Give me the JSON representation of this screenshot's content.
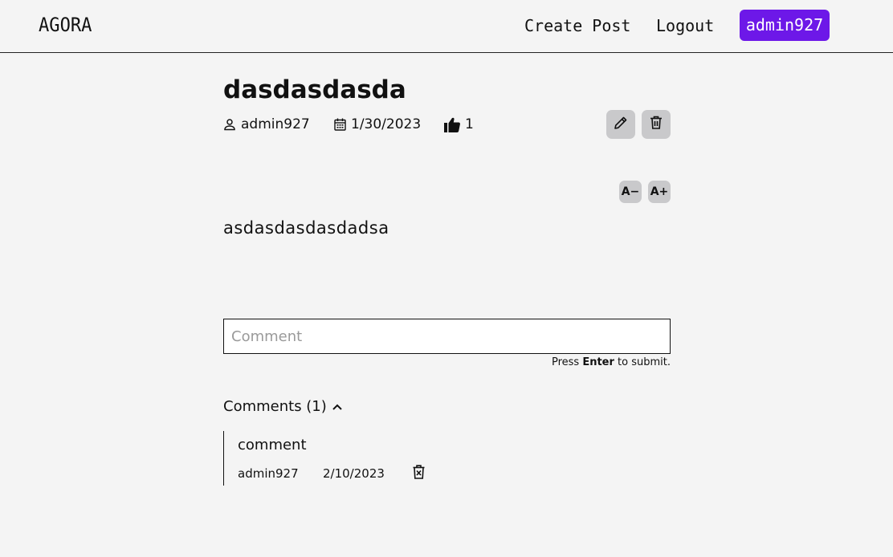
{
  "navbar": {
    "brand": "AGORA",
    "create_post_label": "Create Post",
    "logout_label": "Logout",
    "user_label": "admin927",
    "user_button_color": "#6d18e8"
  },
  "post": {
    "title": "dasdasdasda",
    "author": "admin927",
    "date": "1/30/2023",
    "likes": "1",
    "body": "asdasdasdasdadsa",
    "font_decrease_label": "A−",
    "font_increase_label": "A+",
    "icons": {
      "author": "person-icon",
      "date": "calendar-icon",
      "likes": "thumbs-up-icon",
      "edit": "pencil-icon",
      "delete": "trash-icon"
    }
  },
  "comment_form": {
    "placeholder": "Comment",
    "hint_prefix": "Press ",
    "hint_key": "Enter",
    "hint_suffix": " to submit."
  },
  "comments": {
    "header": "Comments (1)",
    "toggle_icon": "chevron-up-icon",
    "items": [
      {
        "text": "comment",
        "author": "admin927",
        "date": "2/10/2023",
        "delete_icon": "trash-x-icon"
      }
    ]
  }
}
